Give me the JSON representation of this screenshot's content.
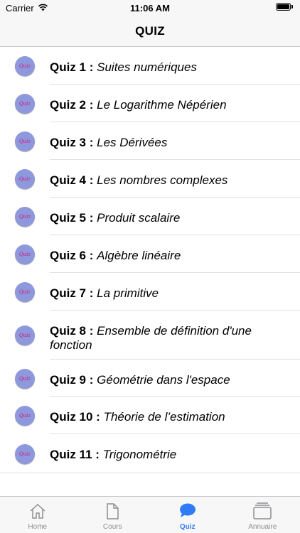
{
  "status_bar": {
    "carrier": "Carrier",
    "time": "11:06 AM",
    "wifi_icon": "wifi-icon",
    "battery_icon": "battery-icon",
    "battery_level": 1.0
  },
  "nav": {
    "title": "QUIZ"
  },
  "quiz_icon": {
    "label": "Quiz",
    "color": "#8e98dc",
    "text_color": "#d0187a"
  },
  "quizzes": [
    {
      "num": "Quiz 1 :",
      "title": "Suites numériques"
    },
    {
      "num": "Quiz 2 :",
      "title": "Le Logarithme Népérien"
    },
    {
      "num": "Quiz 3 :",
      "title": "Les Dérivées"
    },
    {
      "num": "Quiz 4 :",
      "title": "Les nombres complexes"
    },
    {
      "num": "Quiz 5 :",
      "title": "Produit scalaire"
    },
    {
      "num": "Quiz 6 :",
      "title": "Algèbre linéaire"
    },
    {
      "num": "Quiz 7 :",
      "title": "La primitive"
    },
    {
      "num": "Quiz 8 :",
      "title": "Ensemble de définition d'une fonction"
    },
    {
      "num": "Quiz 9 :",
      "title": "Géométrie dans l'espace"
    },
    {
      "num": "Quiz 10 :",
      "title": "Théorie de l’estimation"
    },
    {
      "num": "Quiz 11 :",
      "title": "Trigonométrie"
    }
  ],
  "tabs": [
    {
      "label": "Home",
      "icon": "home-icon",
      "active": false
    },
    {
      "label": "Cours",
      "icon": "document-icon",
      "active": false
    },
    {
      "label": "Quiz",
      "icon": "chat-bubble-icon",
      "active": true
    },
    {
      "label": "Annuaire",
      "icon": "stacked-cards-icon",
      "active": false
    }
  ],
  "colors": {
    "accent": "#2f7cf6",
    "inactive": "#8e8e93",
    "bar_bg": "#f7f7f7"
  }
}
